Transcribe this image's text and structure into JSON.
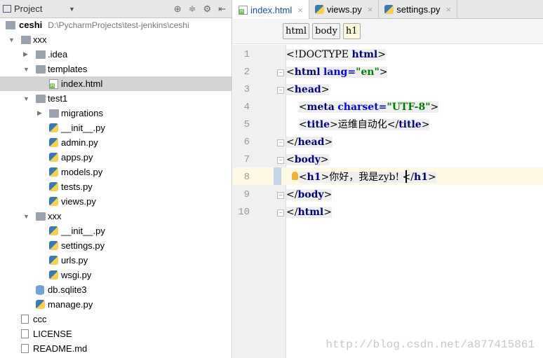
{
  "project_panel": {
    "title": "Project",
    "root": {
      "name": "ceshi",
      "path": "D:\\PycharmProjects\\test-jenkins\\ceshi"
    },
    "tree": [
      {
        "label": "xxx",
        "level": 1,
        "type": "folder",
        "expanded": true
      },
      {
        "label": ".idea",
        "level": 2,
        "type": "folder",
        "expanded": false
      },
      {
        "label": "templates",
        "level": 2,
        "type": "folder",
        "expanded": true
      },
      {
        "label": "index.html",
        "level": 3,
        "type": "html",
        "selected": true
      },
      {
        "label": "test1",
        "level": 2,
        "type": "folder",
        "expanded": true
      },
      {
        "label": "migrations",
        "level": 3,
        "type": "folder",
        "expanded": false
      },
      {
        "label": "__init__.py",
        "level": 3,
        "type": "py"
      },
      {
        "label": "admin.py",
        "level": 3,
        "type": "py"
      },
      {
        "label": "apps.py",
        "level": 3,
        "type": "py"
      },
      {
        "label": "models.py",
        "level": 3,
        "type": "py"
      },
      {
        "label": "tests.py",
        "level": 3,
        "type": "py"
      },
      {
        "label": "views.py",
        "level": 3,
        "type": "py"
      },
      {
        "label": "xxx",
        "level": 2,
        "type": "folder",
        "expanded": true
      },
      {
        "label": "__init__.py",
        "level": 3,
        "type": "py"
      },
      {
        "label": "settings.py",
        "level": 3,
        "type": "py"
      },
      {
        "label": "urls.py",
        "level": 3,
        "type": "py"
      },
      {
        "label": "wsgi.py",
        "level": 3,
        "type": "py"
      },
      {
        "label": "db.sqlite3",
        "level": 2,
        "type": "db"
      },
      {
        "label": "manage.py",
        "level": 2,
        "type": "py"
      },
      {
        "label": "ccc",
        "level": 1,
        "type": "file"
      },
      {
        "label": "LICENSE",
        "level": 1,
        "type": "file"
      },
      {
        "label": "README.md",
        "level": 1,
        "type": "file"
      }
    ]
  },
  "tabs": [
    {
      "label": "index.html",
      "active": true
    },
    {
      "label": "views.py"
    },
    {
      "label": "settings.py"
    }
  ],
  "breadcrumbs": [
    "html",
    "body",
    "h1"
  ],
  "code_lines": [
    "<!DOCTYPE html>",
    "<html lang=\"en\">",
    "<head>",
    "    <meta charset=\"UTF-8\">",
    "    <title>运维自动化</title>",
    "</head>",
    "<body>",
    "    <h1>你好，我是zyb! </h1>",
    "</body>",
    "</html>"
  ],
  "current_line": 8,
  "watermark": "http://blog.csdn.net/a877415861"
}
